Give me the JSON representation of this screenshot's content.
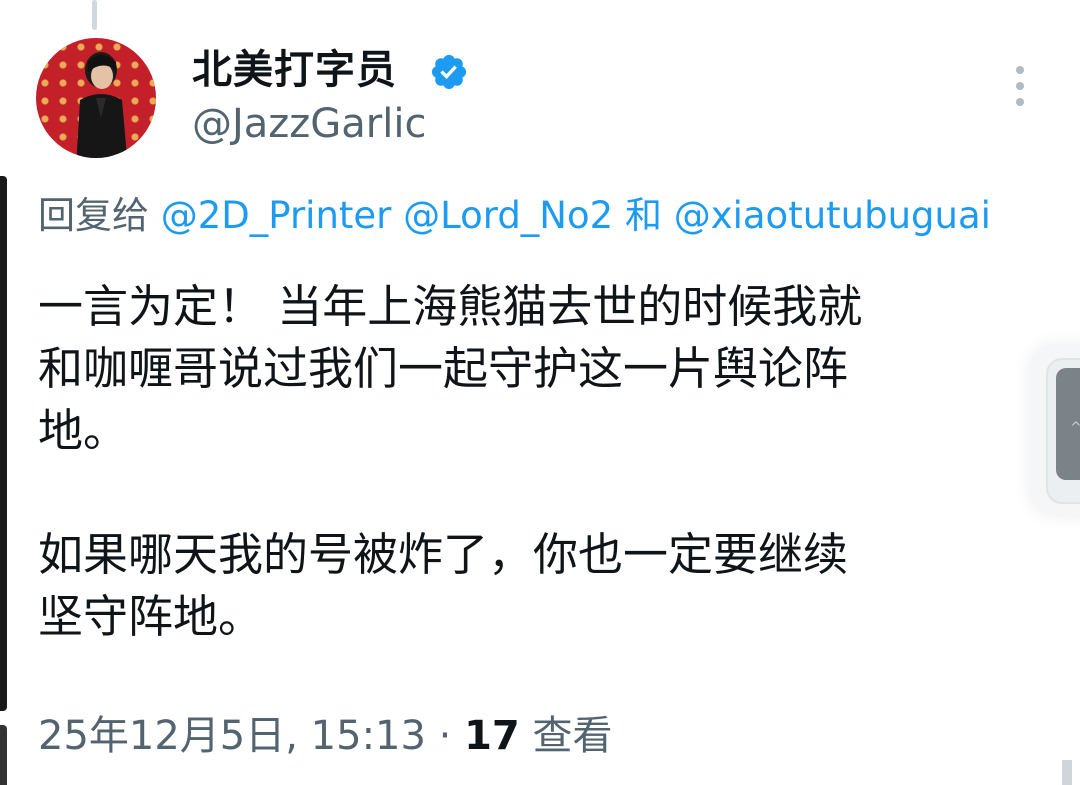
{
  "author": {
    "display_name": "北美打字员",
    "handle": "@JazzGarlic",
    "verified": true
  },
  "reply_to": {
    "prefix": "回复给",
    "mention_1": "@2D_Printer",
    "mention_2": "@Lord_No2",
    "conjunction": "和",
    "mention_3": "@xiaotutubuguai"
  },
  "tweet": {
    "text": "一言为定！ 当年上海熊猫去世的时候我就\n和咖喱哥说过我们一起守护这一片舆论阵\n地。\n\n如果哪天我的号被炸了，你也一定要继续\n坚守阵地。"
  },
  "meta": {
    "timestamp": "25年12月5日, 15:13 · ",
    "views_count": "17",
    "views_label": " 查看"
  },
  "icons": {
    "verified": "verified-badge-icon",
    "more": "more-options-icon"
  },
  "colors": {
    "accent": "#1d9bf0",
    "secondary_text": "#536471",
    "primary_text": "#0f1419"
  }
}
